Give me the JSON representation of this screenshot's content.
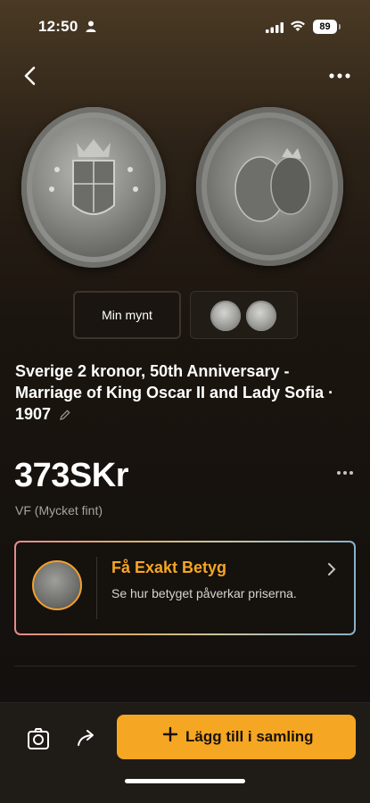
{
  "status": {
    "time": "12:50",
    "battery": "89"
  },
  "icons": {
    "back": "chevron-left-icon",
    "more": "ellipsis-icon",
    "edit": "pencil-icon",
    "camera": "camera-icon",
    "share": "share-icon",
    "plus": "plus-icon",
    "chevron": "chevron-right-icon"
  },
  "thumbnails": {
    "mine_label": "Min mynt"
  },
  "coin": {
    "title": "Sverige 2 kronor, 50th Anniversary - Marriage of King Oscar II and Lady Sofia · 1907",
    "price": "373SKr",
    "grade": "VF (Mycket fint)"
  },
  "grade_card": {
    "title": "Få Exakt Betyg",
    "description": "Se hur betyget påverkar priserna."
  },
  "bottom_bar": {
    "add_label": "Lägg till i samling"
  },
  "colors": {
    "accent": "#f5a623",
    "background": "#15110d"
  }
}
